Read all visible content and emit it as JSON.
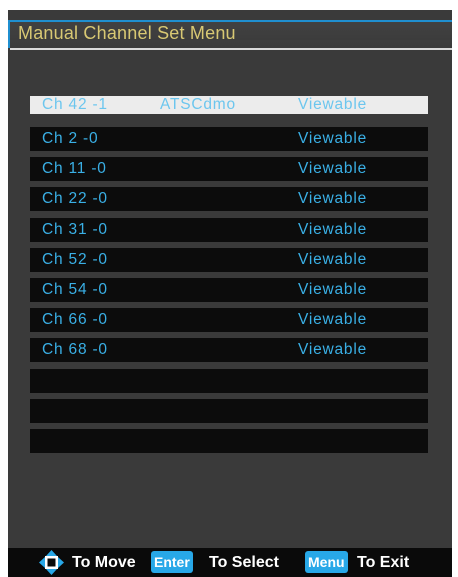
{
  "menu": {
    "title": "Manual Channel Set Menu"
  },
  "channels": [
    {
      "channel": "Ch 42 -1",
      "type": "ATSCdmo",
      "status": "Viewable",
      "selected": true
    },
    {
      "channel": "Ch 2 -0",
      "type": "",
      "status": "Viewable"
    },
    {
      "channel": "Ch 11 -0",
      "type": "",
      "status": "Viewable"
    },
    {
      "channel": "Ch 22 -0",
      "type": "",
      "status": "Viewable"
    },
    {
      "channel": "Ch 31 -0",
      "type": "",
      "status": "Viewable"
    },
    {
      "channel": "Ch 52 -0",
      "type": "",
      "status": "Viewable"
    },
    {
      "channel": "Ch 54 -0",
      "type": "",
      "status": "Viewable"
    },
    {
      "channel": "Ch 66 -0",
      "type": "",
      "status": "Viewable"
    },
    {
      "channel": "Ch 68 -0",
      "type": "",
      "status": "Viewable"
    },
    {
      "channel": "",
      "type": "",
      "status": ""
    },
    {
      "channel": "",
      "type": "",
      "status": ""
    },
    {
      "channel": "",
      "type": "",
      "status": ""
    }
  ],
  "footer": {
    "nav_icon": "four-way-arrow-icon",
    "move_label": "To Move",
    "enter_key": "Enter",
    "select_label": "To Select",
    "menu_key": "Menu",
    "exit_label": "To Exit"
  },
  "colors": {
    "panel_bg": "#3a3a3a",
    "title_text": "#d8c873",
    "accent_blue": "#28a8e8",
    "row_text": "#3ab0e6",
    "row_bg": "#0c0c0c",
    "selected_row_bg": "#ececec"
  }
}
